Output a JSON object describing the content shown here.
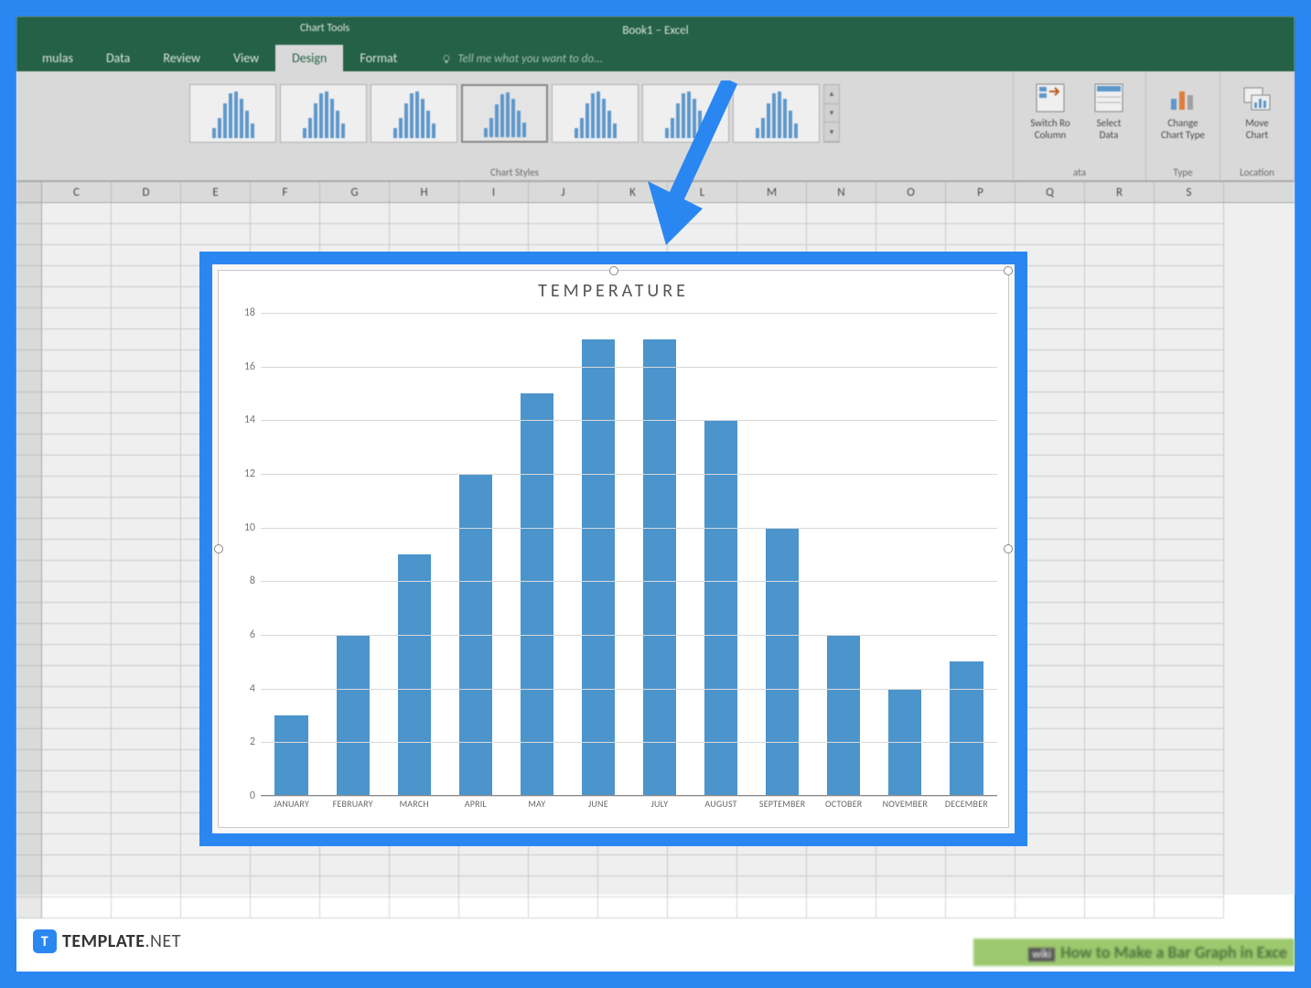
{
  "window": {
    "chart_tools_label": "Chart Tools",
    "doc_title": "Book1 – Excel"
  },
  "tabs": {
    "items": [
      "mulas",
      "Data",
      "Review",
      "View",
      "Design",
      "Format"
    ],
    "active_index": 4,
    "tell_me": "Tell me what you want to do..."
  },
  "ribbon": {
    "groups": {
      "chart_styles": "Chart Styles",
      "data": "ata",
      "type": "Type",
      "location": "Location"
    },
    "buttons": {
      "switch": "Switch Ro\nColumn",
      "select_data": "Select\nData",
      "change_type": "Change\nChart Type",
      "move_chart": "Move\nChart"
    }
  },
  "columns": [
    "C",
    "D",
    "E",
    "F",
    "G",
    "H",
    "I",
    "J",
    "K",
    "L",
    "M",
    "N",
    "O",
    "P",
    "Q",
    "R",
    "S"
  ],
  "chart_data": {
    "type": "bar",
    "title": "TEMPERATURE",
    "categories": [
      "JANUARY",
      "FEBRUARY",
      "MARCH",
      "APRIL",
      "MAY",
      "JUNE",
      "JULY",
      "AUGUST",
      "SEPTEMBER",
      "OCTOBER",
      "NOVEMBER",
      "DECEMBER"
    ],
    "values": [
      3,
      6,
      9,
      12,
      15,
      17,
      17,
      14,
      10,
      6,
      4,
      5
    ],
    "ylim": [
      0,
      18
    ],
    "y_ticks": [
      0,
      2,
      4,
      6,
      8,
      10,
      12,
      14,
      16,
      18
    ],
    "xlabel": "",
    "ylabel": ""
  },
  "badge": {
    "brand_bold": "TEMPLATE",
    "brand_light": ".NET",
    "logo_letter": "T"
  },
  "wiki": {
    "prefix": "wiki",
    "text": "How to Make a Bar Graph in Exce"
  }
}
